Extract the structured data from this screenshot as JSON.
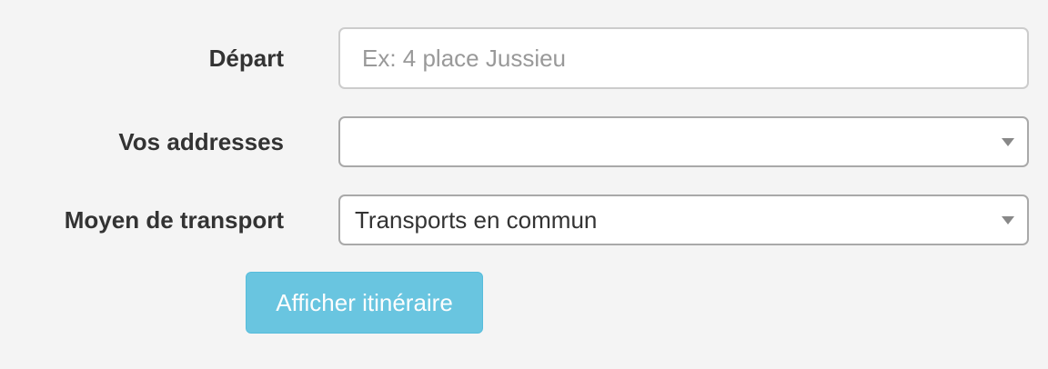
{
  "form": {
    "depart": {
      "label": "Départ",
      "placeholder": "Ex: 4 place Jussieu",
      "value": ""
    },
    "addresses": {
      "label": "Vos addresses",
      "selected": ""
    },
    "transport": {
      "label": "Moyen de transport",
      "selected": "Transports en commun"
    },
    "submit_label": "Afficher itinéraire"
  },
  "icons": {
    "dropdown": "chevron-down-icon"
  },
  "colors": {
    "background": "#f4f4f4",
    "button": "#5bc0de",
    "button_text": "#ffffff",
    "label_text": "#333333",
    "placeholder_text": "#999999"
  }
}
